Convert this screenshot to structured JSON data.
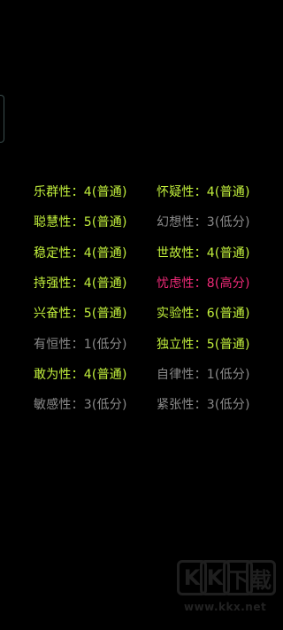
{
  "traits": {
    "items": [
      {
        "text": "乐群性：4(普通)",
        "level": "normal"
      },
      {
        "text": "怀疑性：4(普通)",
        "level": "normal"
      },
      {
        "text": "聪慧性：5(普通)",
        "level": "normal"
      },
      {
        "text": "幻想性：3(低分)",
        "level": "low"
      },
      {
        "text": "稳定性：4(普通)",
        "level": "normal"
      },
      {
        "text": "世故性：4(普通)",
        "level": "normal"
      },
      {
        "text": "持强性：4(普通)",
        "level": "normal"
      },
      {
        "text": "忧虑性：8(高分)",
        "level": "high"
      },
      {
        "text": "兴奋性：5(普通)",
        "level": "normal"
      },
      {
        "text": "实验性：6(普通)",
        "level": "normal"
      },
      {
        "text": "有恒性：1(低分)",
        "level": "low"
      },
      {
        "text": "独立性：5(普通)",
        "level": "normal"
      },
      {
        "text": "敢为性：4(普通)",
        "level": "normal"
      },
      {
        "text": "自律性：1(低分)",
        "level": "low"
      },
      {
        "text": "敏感性：3(低分)",
        "level": "low"
      },
      {
        "text": "紧张性：3(低分)",
        "level": "low"
      }
    ]
  },
  "colors": {
    "normal": "#c2f03c",
    "low": "#8a8a8a",
    "high": "#f02a78",
    "background": "#000000"
  },
  "watermark": {
    "letter_1": "K",
    "letter_2": "K",
    "letter_3": "下",
    "letter_4": "载",
    "domain": "www.kkx.net"
  }
}
